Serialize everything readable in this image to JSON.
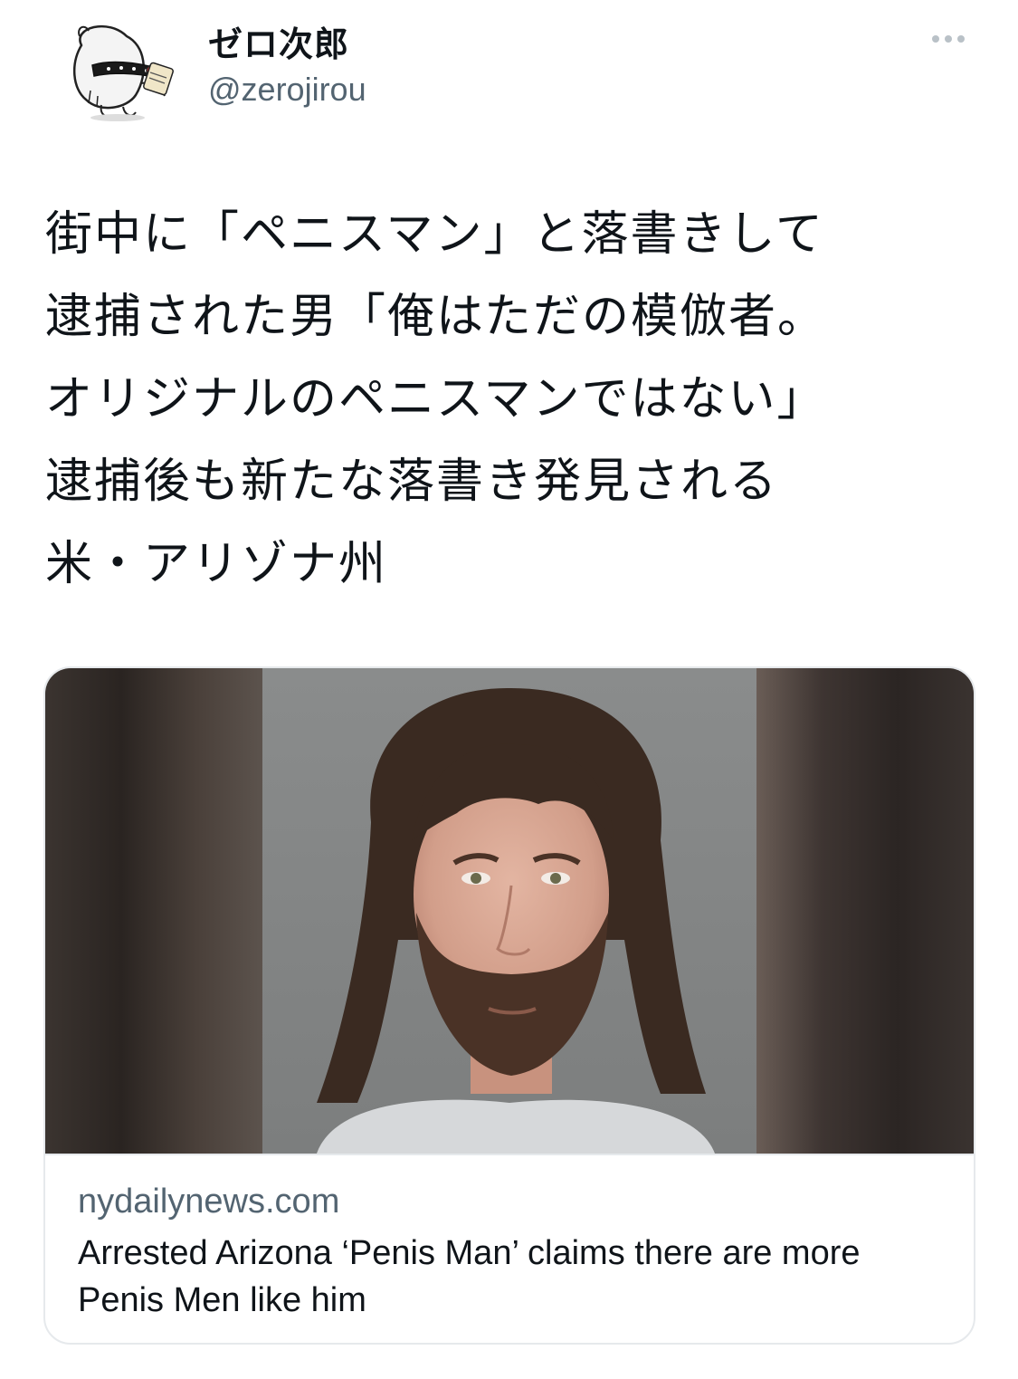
{
  "user": {
    "display_name": "ゼロ次郎",
    "handle": "@zerojirou",
    "avatar_icon": "cartoon-character-avatar"
  },
  "header": {
    "more_icon": "more-horizontal-icon"
  },
  "tweet": {
    "lines": [
      "街中に「ペニスマン」と落書きして",
      "逮捕された男「俺はただの模倣者。",
      "オリジナルのペニスマンではない」",
      "逮捕後も新たな落書き発見される",
      "米・アリゾナ州"
    ]
  },
  "card": {
    "domain": "nydailynews.com",
    "title": "Arrested Arizona ‘Penis Man’ claims there are more Penis Men like him",
    "image": "mugshot-photo"
  },
  "colors": {
    "text": "#0f1419",
    "secondary": "#536471",
    "border": "#e6e9ec",
    "dots": "#b9c1c7"
  }
}
